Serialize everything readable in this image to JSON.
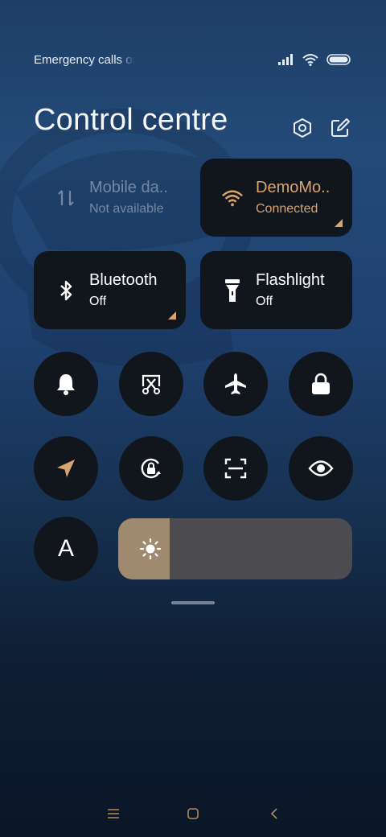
{
  "status_bar": {
    "carrier_text": "Emergency calls only",
    "icons": [
      "signal-icon",
      "wifi-icon",
      "battery-icon"
    ]
  },
  "header": {
    "title": "Control centre",
    "icons": [
      "settings-icon",
      "edit-icon"
    ]
  },
  "tiles": {
    "mobile_data": {
      "label": "Mobile da..",
      "status": "Not available",
      "icon": "mobile-data-icon",
      "enabled": false
    },
    "wifi": {
      "label": "DemoMo..",
      "status": "Connected",
      "icon": "wifi-icon",
      "active": true
    },
    "bluetooth": {
      "label": "Bluetooth",
      "status": "Off",
      "icon": "bluetooth-icon"
    },
    "flashlight": {
      "label": "Flashlight",
      "status": "Off",
      "icon": "flashlight-icon"
    }
  },
  "toggles": [
    "bell-icon",
    "screenshot-icon",
    "airplane-icon",
    "lock-icon",
    "location-icon",
    "rotation-lock-icon",
    "scanner-icon",
    "eye-icon",
    "auto-brightness-icon"
  ],
  "auto_brightness_label": "A",
  "brightness": {
    "level": 0.22,
    "icon": "sun-icon"
  },
  "colors": {
    "accent": "#d9a56d",
    "tile": "#11151c",
    "slider_fill": "#9f8a6f"
  },
  "navigation": [
    "menu-icon",
    "home-icon",
    "back-icon"
  ]
}
